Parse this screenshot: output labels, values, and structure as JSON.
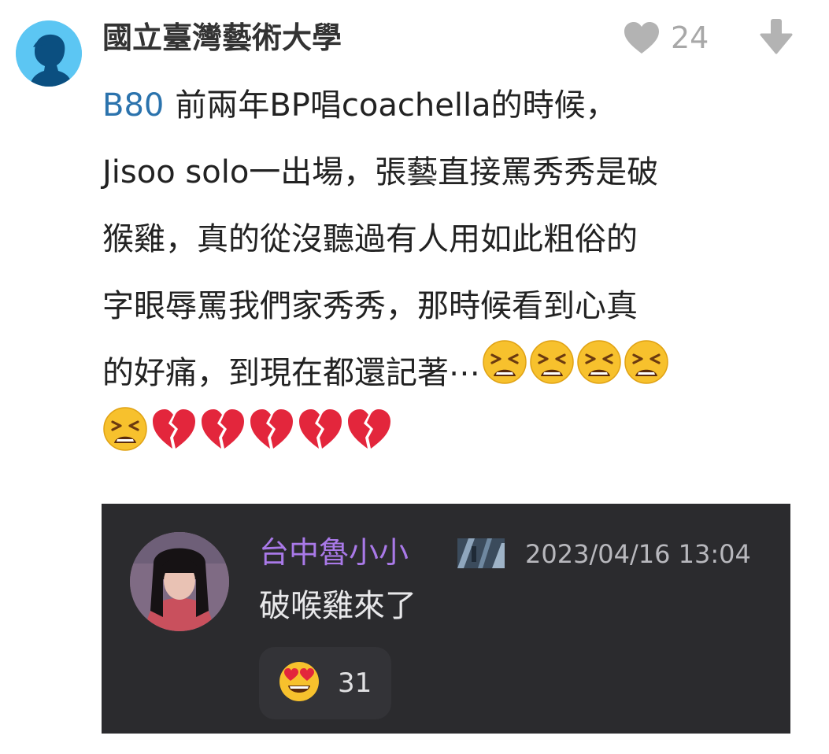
{
  "post": {
    "author": "國立臺灣藝術大學",
    "like_count": "24",
    "reply_ref": "B80",
    "lines": [
      "前兩年BP唱coachella的時候，",
      "Jisoo solo一出場，張藝直接罵秀秀是破",
      "猴雞，真的從沒聽過有人用如此粗俗的",
      "字眼辱罵我們家秀秀，那時候看到心真",
      "的好痛，到現在都還記著⋯"
    ],
    "icons": {
      "avatar": "person-silhouette-icon",
      "like": "heart-icon",
      "dislike": "down-arrow-icon",
      "emoji_tired": "tired-face-emoji",
      "emoji_broken_heart": "broken-heart-emoji"
    }
  },
  "reply": {
    "name": "台中魯小小",
    "timestamp": "2023/04/16 13:04",
    "text": "破喉雞來了",
    "reaction_count": "31",
    "reaction_icon": "heart-eyes-emoji"
  },
  "colors": {
    "avatar_bg": "#5cc6f3",
    "reply_ref": "#2b73ad",
    "reply_name": "#a979e8",
    "card_bg": "#2b2b2e"
  }
}
